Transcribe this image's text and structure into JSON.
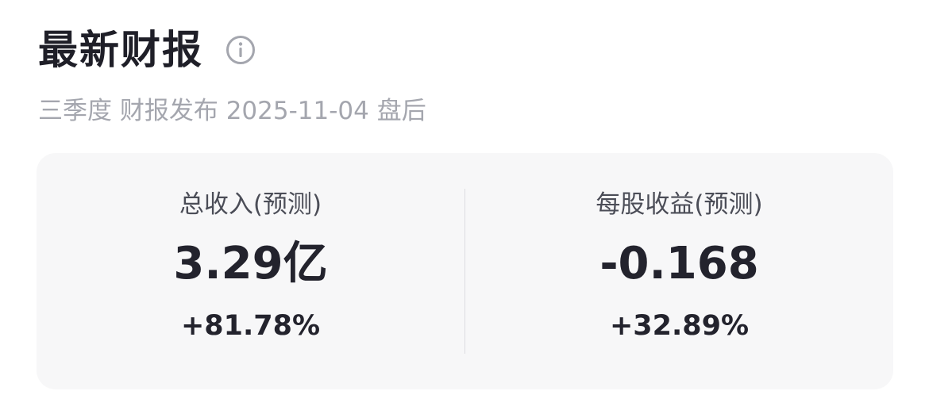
{
  "section": {
    "title": "最新财报",
    "info_icon": "info-circle-icon",
    "subtitle": "三季度 财报发布 2025-11-04 盘后"
  },
  "metrics": [
    {
      "label": "总收入(预测)",
      "value": "3.29亿",
      "change": "+81.78%"
    },
    {
      "label": "每股收益(预测)",
      "value": "-0.168",
      "change": "+32.89%"
    }
  ],
  "colors": {
    "title": "#1f1f28",
    "subtitle": "#a4a6ae",
    "card_background": "#f7f7f8",
    "label": "#4b4d57",
    "value": "#23232d"
  }
}
